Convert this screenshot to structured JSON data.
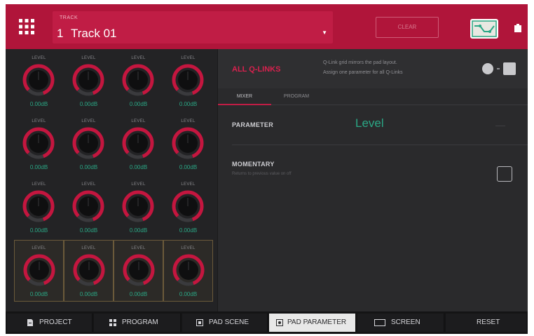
{
  "header": {
    "track_label": "TRACK",
    "track_number": "1",
    "track_name": "Track 01",
    "clear_button": "CLEAR"
  },
  "knob_grid": {
    "knobs": [
      {
        "label": "LEVEL",
        "value": "0.00dB"
      },
      {
        "label": "LEVEL",
        "value": "0.00dB"
      },
      {
        "label": "LEVEL",
        "value": "0.00dB"
      },
      {
        "label": "LEVEL",
        "value": "0.00dB"
      },
      {
        "label": "LEVEL",
        "value": "0.00dB"
      },
      {
        "label": "LEVEL",
        "value": "0.00dB"
      },
      {
        "label": "LEVEL",
        "value": "0.00dB"
      },
      {
        "label": "LEVEL",
        "value": "0.00dB"
      },
      {
        "label": "LEVEL",
        "value": "0.00dB"
      },
      {
        "label": "LEVEL",
        "value": "0.00dB"
      },
      {
        "label": "LEVEL",
        "value": "0.00dB"
      },
      {
        "label": "LEVEL",
        "value": "0.00dB"
      },
      {
        "label": "LEVEL",
        "value": "0.00dB"
      },
      {
        "label": "LEVEL",
        "value": "0.00dB"
      },
      {
        "label": "LEVEL",
        "value": "0.00dB"
      },
      {
        "label": "LEVEL",
        "value": "0.00dB"
      }
    ]
  },
  "qlinks": {
    "title": "ALL Q-LINKS",
    "description_line1": "Q-Link grid mirrors the pad layout.",
    "description_line2": "Assign one parameter for all Q-Links",
    "tabs": [
      "MIXER",
      "PROGRAM"
    ],
    "parameter_label": "PARAMETER",
    "parameter_value": "Level",
    "momentary_label": "MOMENTARY",
    "momentary_sublabel": "Returns to previous value on off"
  },
  "bottom_bar": {
    "project": "PROJECT",
    "program": "PROGRAM",
    "pad_scene": "PAD SCENE",
    "pad_parameter": "PAD PARAMETER",
    "screen": "SCREEN",
    "reset": "RESET"
  },
  "colors": {
    "accent_red": "#b0153a",
    "value_green": "#2aa785",
    "knob_ring": "#c4163f"
  }
}
